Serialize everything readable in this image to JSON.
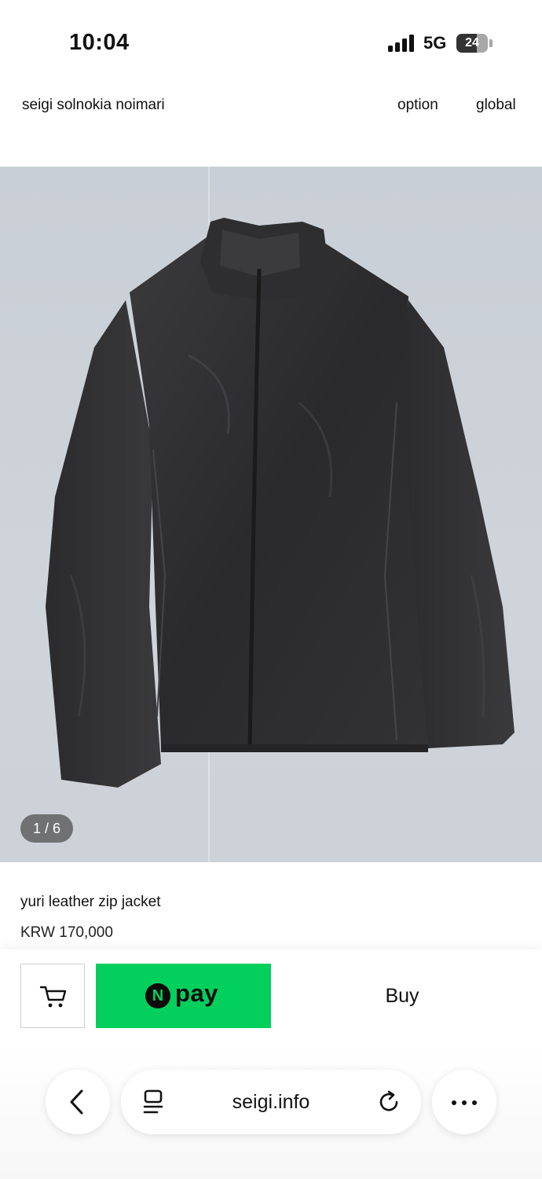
{
  "status_bar": {
    "time": "10:04",
    "network": "5G",
    "battery": "24"
  },
  "header": {
    "brand": "seigi solnokia noimari",
    "nav": {
      "option": "option",
      "global": "global"
    }
  },
  "gallery": {
    "counter": "1 / 6",
    "image_subject": "black leather zip jacket"
  },
  "product": {
    "name": "yuri leather zip jacket",
    "price": "KRW 170,000"
  },
  "purchase_bar": {
    "cart_icon": "cart-icon",
    "npay_mark": "N",
    "npay_label": "pay",
    "buy_label": "Buy",
    "npay_color": "#03cf5d"
  },
  "browser": {
    "url": "seigi.info",
    "icons": [
      "back-arrow-icon",
      "reader-icon",
      "reload-icon",
      "more-icon"
    ]
  }
}
